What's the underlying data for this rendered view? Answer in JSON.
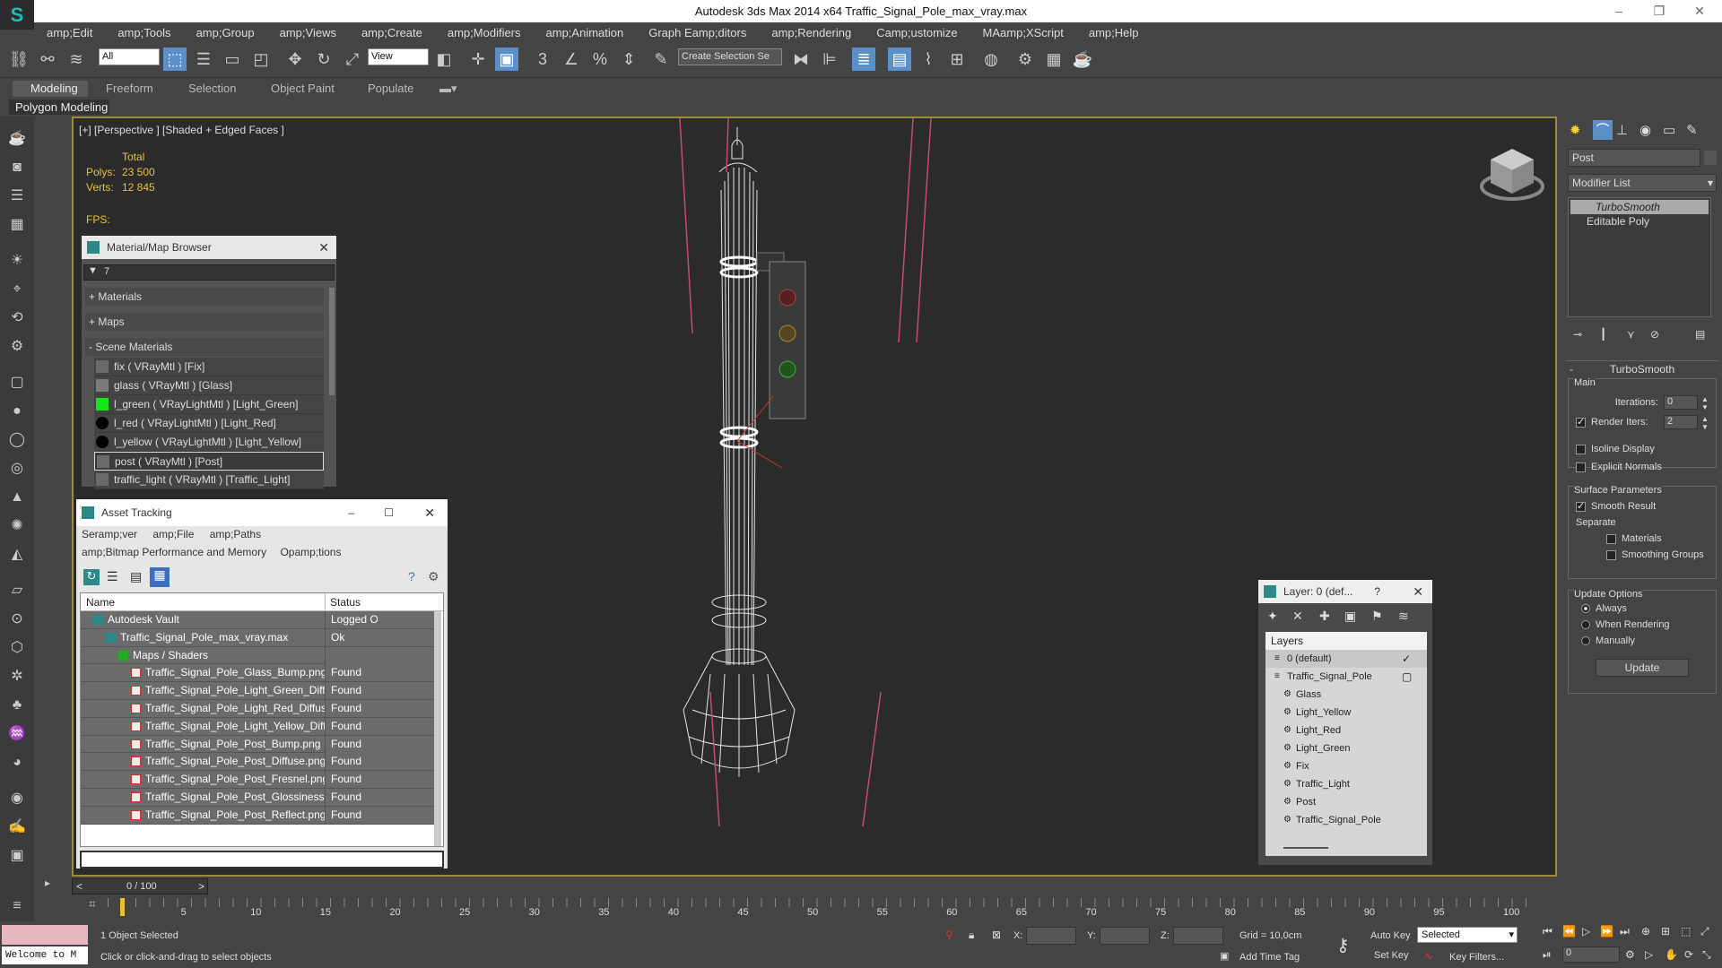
{
  "window": {
    "title": "Autodesk 3ds Max  2014 x64     Traffic_Signal_Pole_max_vray.max"
  },
  "menu": [
    "amp;Edit",
    "amp;Tools",
    "amp;Group",
    "amp;Views",
    "amp;Create",
    "amp;Modifiers",
    "amp;Animation",
    "Graph Eamp;ditors",
    "amp;Rendering",
    "Camp;ustomize",
    "MAamp;XScript",
    "amp;Help"
  ],
  "toolbar": {
    "filter": "All",
    "refcoord": "View",
    "selection_set": "Create Selection Se"
  },
  "ribbon": {
    "tabs": [
      "Modeling",
      "Freeform",
      "Selection",
      "Object Paint",
      "Populate"
    ],
    "sub": "Polygon Modeling"
  },
  "viewport": {
    "label": "[+] [Perspective ] [Shaded + Edged Faces ]",
    "stats": {
      "header": "Total",
      "polys_label": "Polys:",
      "polys": "23 500",
      "verts_label": "Verts:",
      "verts": "12 845",
      "fps_label": "FPS:"
    }
  },
  "material_browser": {
    "title": "Material/Map Browser",
    "search": "7",
    "groups": [
      "+ Materials",
      "+ Maps",
      "- Scene Materials"
    ],
    "items": [
      {
        "label": "fix  ( VRayMtl ) [Fix]",
        "swatch": "#6a6a6a"
      },
      {
        "label": "glass  ( VRayMtl ) [Glass]",
        "swatch": "#7a7a7a"
      },
      {
        "label": "l_green  ( VRayLightMtl ) [Light_Green]",
        "swatch": "#19e619"
      },
      {
        "label": "l_red  ( VRayLightMtl ) [Light_Red]",
        "swatch": "#000000"
      },
      {
        "label": "l_yellow  ( VRayLightMtl ) [Light_Yellow]",
        "swatch": "#000000"
      },
      {
        "label": "post  ( VRayMtl ) [Post]",
        "swatch": "#6a6a6a"
      },
      {
        "label": "traffic_light  ( VRayMtl ) [Traffic_Light]",
        "swatch": "#6a6a6a"
      }
    ]
  },
  "asset_tracking": {
    "title": "Asset Tracking",
    "menu": [
      "Seramp;ver",
      "amp;File",
      "amp;Paths",
      "amp;Bitmap Performance and Memory",
      "Opamp;tions"
    ],
    "columns": [
      "Name",
      "Status"
    ],
    "rows": [
      {
        "name": "Autodesk Vault",
        "status": "Logged O",
        "indent": 0
      },
      {
        "name": "Traffic_Signal_Pole_max_vray.max",
        "status": "Ok",
        "indent": 1
      },
      {
        "name": "Maps / Shaders",
        "status": "",
        "indent": 2
      },
      {
        "name": "Traffic_Signal_Pole_Glass_Bump.png",
        "status": "Found",
        "indent": 3
      },
      {
        "name": "Traffic_Signal_Pole_Light_Green_Diffuse.png",
        "status": "Found",
        "indent": 3
      },
      {
        "name": "Traffic_Signal_Pole_Light_Red_Diffuse.png",
        "status": "Found",
        "indent": 3
      },
      {
        "name": "Traffic_Signal_Pole_Light_Yellow_Diffuse.png",
        "status": "Found",
        "indent": 3
      },
      {
        "name": "Traffic_Signal_Pole_Post_Bump.png",
        "status": "Found",
        "indent": 3
      },
      {
        "name": "Traffic_Signal_Pole_Post_Diffuse.png",
        "status": "Found",
        "indent": 3
      },
      {
        "name": "Traffic_Signal_Pole_Post_Fresnel.png",
        "status": "Found",
        "indent": 3
      },
      {
        "name": "Traffic_Signal_Pole_Post_Glossiness.png",
        "status": "Found",
        "indent": 3
      },
      {
        "name": "Traffic_Signal_Pole_Post_Reflect.png",
        "status": "Found",
        "indent": 3
      }
    ]
  },
  "layer_manager": {
    "title": "Layer: 0 (def...",
    "help": "?",
    "header": "Layers",
    "rows": [
      "0 (default)",
      "Traffic_Signal_Pole",
      "Glass",
      "Light_Yellow",
      "Light_Red",
      "Light_Green",
      "Fix",
      "Traffic_Light",
      "Post",
      "Traffic_Signal_Pole"
    ]
  },
  "command_panel": {
    "object_name": "Post",
    "modifier_list": "Modifier List",
    "stack": [
      "TurboSmooth",
      "Editable Poly"
    ],
    "rollout_title": "TurboSmooth",
    "main_label": "Main",
    "iterations_label": "Iterations:",
    "iterations": "0",
    "render_iters_label": "Render Iters:",
    "render_iters": "2",
    "isoline": "Isoline Display",
    "explicit_normals": "Explicit Normals",
    "surface_params": "Surface Parameters",
    "smooth_result": "Smooth Result",
    "separate": "Separate",
    "materials": "Materials",
    "smoothing_groups": "Smoothing Groups",
    "update_options": "Update Options",
    "always": "Always",
    "when_rendering": "When Rendering",
    "manually": "Manually",
    "update_button": "Update"
  },
  "timeline": {
    "frame": "0 / 100",
    "ticks": [
      "5",
      "10",
      "15",
      "20",
      "25",
      "30",
      "35",
      "40",
      "45",
      "50",
      "55",
      "60",
      "65",
      "70",
      "75",
      "80",
      "85",
      "90",
      "95",
      "100"
    ]
  },
  "status": {
    "welcome": "Welcome to M",
    "selected": "1 Object Selected",
    "hint": "Click or click-and-drag to select objects",
    "x_label": "X:",
    "y_label": "Y:",
    "z_label": "Z:",
    "grid": "Grid = 10,0cm",
    "add_time_tag": "Add Time Tag",
    "auto_key": "Auto Key",
    "set_key": "Set Key",
    "key_mode": "Selected",
    "key_filters": "Key Filters...",
    "frame_field": "0"
  },
  "colors": {
    "accent": "#a08a3a",
    "green_light": "#19e619",
    "found_bg": "#6b6b6b"
  }
}
